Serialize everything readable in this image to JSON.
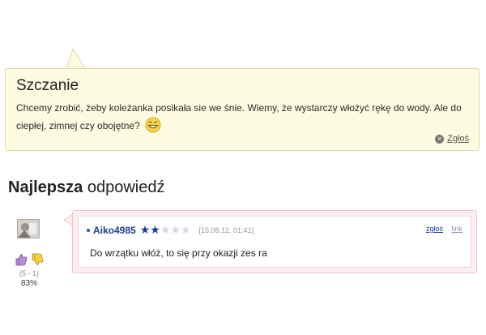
{
  "question": {
    "title": "Szczanie",
    "body": "Chcemy zrobić, żeby koleżanka posikała sie we śnie. Wiemy, że wystarczy włożyć rękę do wody. Ale do ciepłej, zimnej czy obojętne?",
    "report_label": "Zgłoś",
    "emoticon": "laughing-emoji"
  },
  "best_answer": {
    "heading_bold": "Najlepsza",
    "heading_rest": "odpowiedź",
    "username": "Aiko4985",
    "rating": 2,
    "rating_max": 5,
    "date": "[15.08.12, 01:41]",
    "report_label": "zgłoś",
    "link_label": "link",
    "text": "Do wrzątku włóż, to się przy okazji zes ra",
    "votes": {
      "count": "(5 - 1)",
      "percent": "83%"
    }
  },
  "colors": {
    "question_bg": "#fdfbe0",
    "answer_bg": "#fdeff1",
    "username": "#1a3d8f"
  }
}
